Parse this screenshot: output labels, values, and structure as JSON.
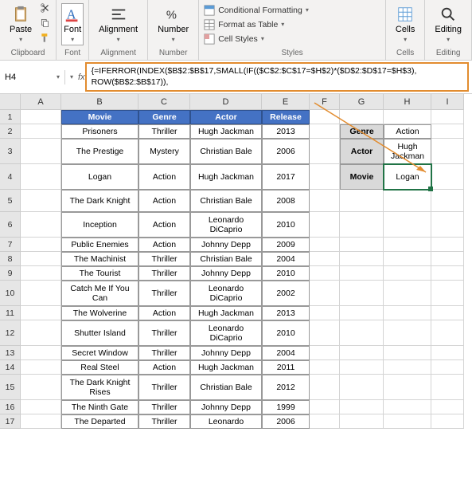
{
  "ribbon": {
    "clipboard": {
      "label": "Clipboard",
      "paste": "Paste"
    },
    "font": {
      "label": "Font",
      "btn": "Font"
    },
    "alignment": {
      "label": "Alignment",
      "btn": "Alignment"
    },
    "number": {
      "label": "Number",
      "btn": "Number"
    },
    "styles": {
      "label": "Styles",
      "cond": "Conditional Formatting",
      "table": "Format as Table",
      "cell": "Cell Styles"
    },
    "cells": {
      "label": "Cells",
      "btn": "Cells"
    },
    "editing": {
      "label": "Editing",
      "btn": "Editing"
    }
  },
  "namebox": "H4",
  "formula": "{=IFERROR(INDEX($B$2:$B$17,SMALL(IF(($C$2:$C$17=$H$2)*($D$2:$D$17=$H$3), ROW($B$2:$B$17)),",
  "columns": [
    "A",
    "B",
    "C",
    "D",
    "E",
    "F",
    "G",
    "H",
    "I"
  ],
  "headers": {
    "movie": "Movie",
    "genre": "Genre",
    "actor": "Actor",
    "release": "Release"
  },
  "rows": [
    {
      "n": "1"
    },
    {
      "n": "2",
      "movie": "Prisoners",
      "genre": "Thriller",
      "actor": "Hugh Jackman",
      "release": "2013"
    },
    {
      "n": "3",
      "movie": "The Prestige",
      "genre": "Mystery",
      "actor": "Christian Bale",
      "release": "2006"
    },
    {
      "n": "4",
      "movie": "Logan",
      "genre": "Action",
      "actor": "Hugh Jackman",
      "release": "2017"
    },
    {
      "n": "5",
      "movie": "The Dark Knight",
      "genre": "Action",
      "actor": "Christian Bale",
      "release": "2008"
    },
    {
      "n": "6",
      "movie": "Inception",
      "genre": "Action",
      "actor": "Leonardo DiCaprio",
      "release": "2010"
    },
    {
      "n": "7",
      "movie": "Public Enemies",
      "genre": "Action",
      "actor": "Johnny Depp",
      "release": "2009"
    },
    {
      "n": "8",
      "movie": "The Machinist",
      "genre": "Thriller",
      "actor": "Christian Bale",
      "release": "2004"
    },
    {
      "n": "9",
      "movie": "The Tourist",
      "genre": "Thriller",
      "actor": "Johnny Depp",
      "release": "2010"
    },
    {
      "n": "10",
      "movie": "Catch Me If You Can",
      "genre": "Thriller",
      "actor": "Leonardo DiCaprio",
      "release": "2002"
    },
    {
      "n": "11",
      "movie": "The Wolverine",
      "genre": "Action",
      "actor": "Hugh Jackman",
      "release": "2013"
    },
    {
      "n": "12",
      "movie": "Shutter Island",
      "genre": "Thriller",
      "actor": "Leonardo DiCaprio",
      "release": "2010"
    },
    {
      "n": "13",
      "movie": "Secret Window",
      "genre": "Thriller",
      "actor": "Johnny Depp",
      "release": "2004"
    },
    {
      "n": "14",
      "movie": "Real Steel",
      "genre": "Action",
      "actor": "Hugh Jackman",
      "release": "2011"
    },
    {
      "n": "15",
      "movie": "The Dark Knight Rises",
      "genre": "Thriller",
      "actor": "Christian Bale",
      "release": "2012"
    },
    {
      "n": "16",
      "movie": "The Ninth Gate",
      "genre": "Thriller",
      "actor": "Johnny Depp",
      "release": "1999"
    },
    {
      "n": "17",
      "movie": "The Departed",
      "genre": "Thriller",
      "actor": "Leonardo",
      "release": "2006"
    }
  ],
  "lookup": {
    "genre_lbl": "Genre",
    "genre_val": "Action",
    "actor_lbl": "Actor",
    "actor_val": "Hugh Jackman",
    "movie_lbl": "Movie",
    "movie_val": "Logan"
  }
}
